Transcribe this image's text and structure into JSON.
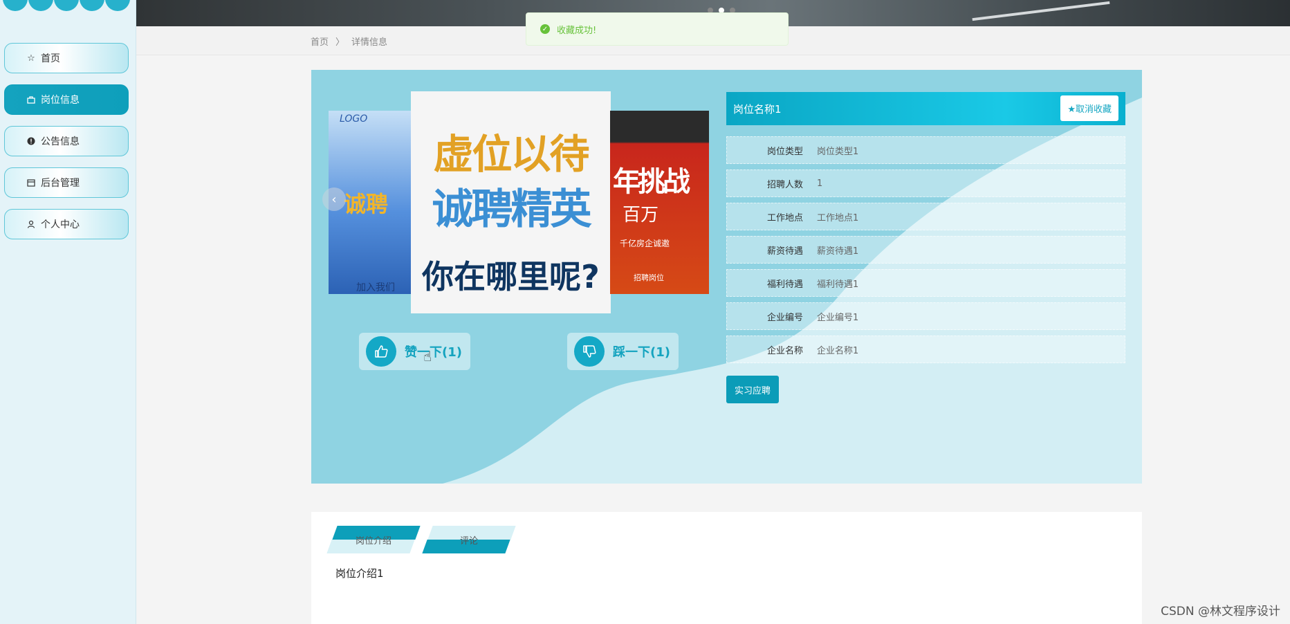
{
  "sidebar": {
    "items": [
      {
        "label": "首页",
        "icon": "star-icon"
      },
      {
        "label": "岗位信息",
        "icon": "bag-icon",
        "active": true
      },
      {
        "label": "公告信息",
        "icon": "alert-icon"
      },
      {
        "label": "后台管理",
        "icon": "calendar-icon"
      },
      {
        "label": "个人中心",
        "icon": "user-icon"
      }
    ]
  },
  "breadcrumb": {
    "home": "首页",
    "separator": "〉",
    "current": "详情信息"
  },
  "toast": {
    "text": "收藏成功!"
  },
  "carousel": {
    "left": {
      "logo": "LOGO",
      "title": "诚聘",
      "bottom": "加入我们"
    },
    "center": {
      "line1": "虚位以待",
      "line2": "诚聘精英",
      "line3": "你在哪里呢?"
    },
    "right": {
      "line1": "年挑战",
      "line2": "百万",
      "line3": "千亿房企诚邀",
      "line4": "招聘岗位"
    }
  },
  "votes": {
    "up_label": "赞一下(1)",
    "down_label": "踩一下(1)"
  },
  "job": {
    "title": "岗位名称1",
    "fav_button": "★取消收藏",
    "fields": [
      {
        "key": "岗位类型",
        "value": "岗位类型1"
      },
      {
        "key": "招聘人数",
        "value": "1"
      },
      {
        "key": "工作地点",
        "value": "工作地点1"
      },
      {
        "key": "薪资待遇",
        "value": "薪资待遇1"
      },
      {
        "key": "福利待遇",
        "value": "福利待遇1"
      },
      {
        "key": "企业编号",
        "value": "企业编号1"
      },
      {
        "key": "企业名称",
        "value": "企业名称1"
      }
    ],
    "apply_button": "实习应聘"
  },
  "tabs": [
    {
      "label": "岗位介绍"
    },
    {
      "label": "评论"
    }
  ],
  "intro_text": "岗位介绍1",
  "watermark": "CSDN @林文程序设计",
  "colors": {
    "accent": "#0d9fba",
    "panel": "#8fd3e2",
    "toast_green": "#67c23a"
  }
}
